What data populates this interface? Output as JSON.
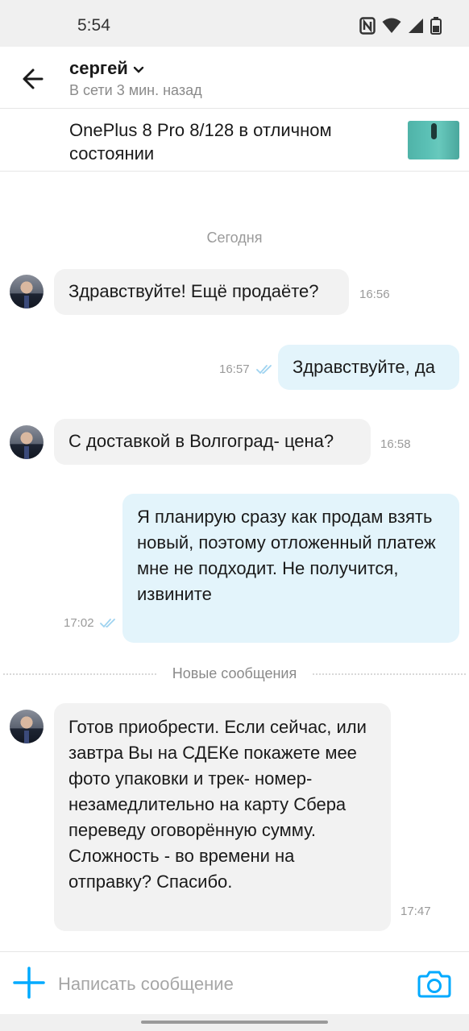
{
  "status_bar": {
    "time": "5:54",
    "icons": [
      "nfc-icon",
      "wifi-icon",
      "signal-icon",
      "battery-icon"
    ]
  },
  "header": {
    "contact_name": "сергей",
    "contact_status": "В сети 3 мин. назад"
  },
  "listing": {
    "title": "OnePlus 8 Pro 8/128 в отличном состоянии"
  },
  "chat": {
    "date_separator": "Сегодня",
    "new_messages_separator": "Новые сообщения",
    "messages": [
      {
        "direction": "in",
        "text": "Здравствуйте! Ещё продаёте?",
        "time": "16:56"
      },
      {
        "direction": "out",
        "text": "Здравствуйте, да",
        "time": "16:57",
        "read": true
      },
      {
        "direction": "in",
        "text": "С доставкой в Волгоград- цена?",
        "time": "16:58"
      },
      {
        "direction": "out",
        "text": "Я планирую сразу как продам взять новый, поэтому отложенный платеж мне не подходит. Не получится, извините",
        "time": "17:02",
        "read": true
      },
      {
        "direction": "in",
        "text": "Готов приобрести. Если сейчас, или завтра Вы на СДЕКе покажете мее фото упаковки и трек- номер- незамедлительно на карту Сбера переведу оговорённую сумму. Сложность - во времени на отправку? Спасибо.",
        "time": "17:47"
      }
    ]
  },
  "composer": {
    "placeholder": "Написать сообщение"
  },
  "colors": {
    "accent": "#00aaff",
    "outgoing_bubble": "#e3f4fb",
    "incoming_bubble": "#f2f2f2",
    "read_ticks": "#9fd3f0"
  }
}
